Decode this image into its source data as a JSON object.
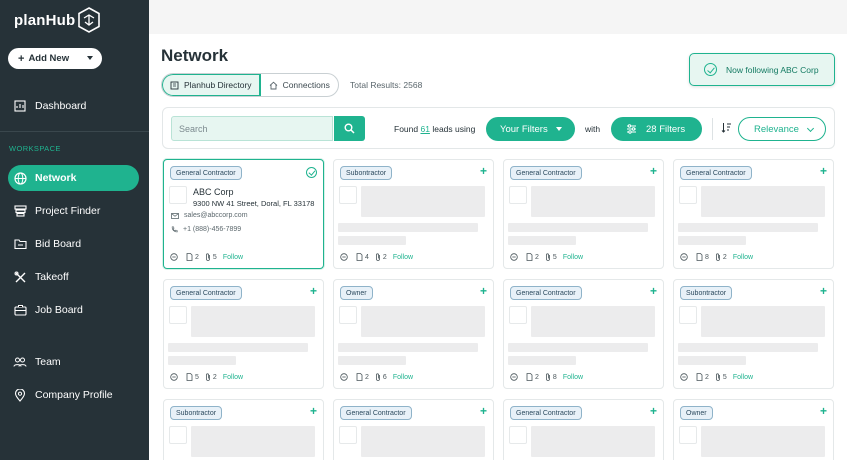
{
  "app": {
    "logo_text": "planHub"
  },
  "sidebar": {
    "add_new": "Add New",
    "dashboard": "Dashboard",
    "workspace_label": "WORKSPACE",
    "items": [
      {
        "label": "Network",
        "icon": "globe-icon",
        "active": true
      },
      {
        "label": "Project Finder",
        "icon": "layers-icon"
      },
      {
        "label": "Bid Board",
        "icon": "folder-icon"
      },
      {
        "label": "Takeoff",
        "icon": "tools-icon"
      },
      {
        "label": "Job Board",
        "icon": "briefcase-icon"
      }
    ],
    "team": "Team",
    "company_profile": "Company Profile"
  },
  "page": {
    "title": "Network",
    "tabs": [
      "Planhub Directory",
      "Connections"
    ],
    "total_results": "Total Results: 2568"
  },
  "toast": {
    "message": "Now following ABC Corp"
  },
  "filters": {
    "search_placeholder": "Search",
    "found_prefix": "Found",
    "found_count": "61",
    "found_suffix": "leads using",
    "your_filters": "Your Filters",
    "with": "with",
    "filter_count": "28 Filters",
    "sort": "Relevance"
  },
  "cards": [
    {
      "tag": "General Contractor",
      "selected": true,
      "name": "ABC Corp",
      "address": "9300 NW 41 Street, Doral, FL 33178",
      "email": "sales@abccorp.com",
      "phone": "+1 (888)-456-7899",
      "docs": "2",
      "attach": "5",
      "follow": "Follow"
    },
    {
      "tag": "Subontractor",
      "docs": "4",
      "attach": "2",
      "follow": "Follow"
    },
    {
      "tag": "General Contractor",
      "docs": "2",
      "attach": "5",
      "follow": "Follow"
    },
    {
      "tag": "General Contractor",
      "docs": "8",
      "attach": "2",
      "follow": "Follow"
    },
    {
      "tag": "General Contractor",
      "docs": "5",
      "attach": "2",
      "follow": "Follow"
    },
    {
      "tag": "Owner",
      "docs": "2",
      "attach": "6",
      "follow": "Follow"
    },
    {
      "tag": "General Contractor",
      "docs": "2",
      "attach": "8",
      "follow": "Follow"
    },
    {
      "tag": "Subontractor",
      "docs": "2",
      "attach": "5",
      "follow": "Follow"
    },
    {
      "tag": "Subontractor"
    },
    {
      "tag": "General Contractor"
    },
    {
      "tag": "General Contractor"
    },
    {
      "tag": "Owner"
    }
  ],
  "colors": {
    "accent": "#1fb38f",
    "sidebar": "#263238",
    "tag_bg": "#e8f1f8"
  }
}
